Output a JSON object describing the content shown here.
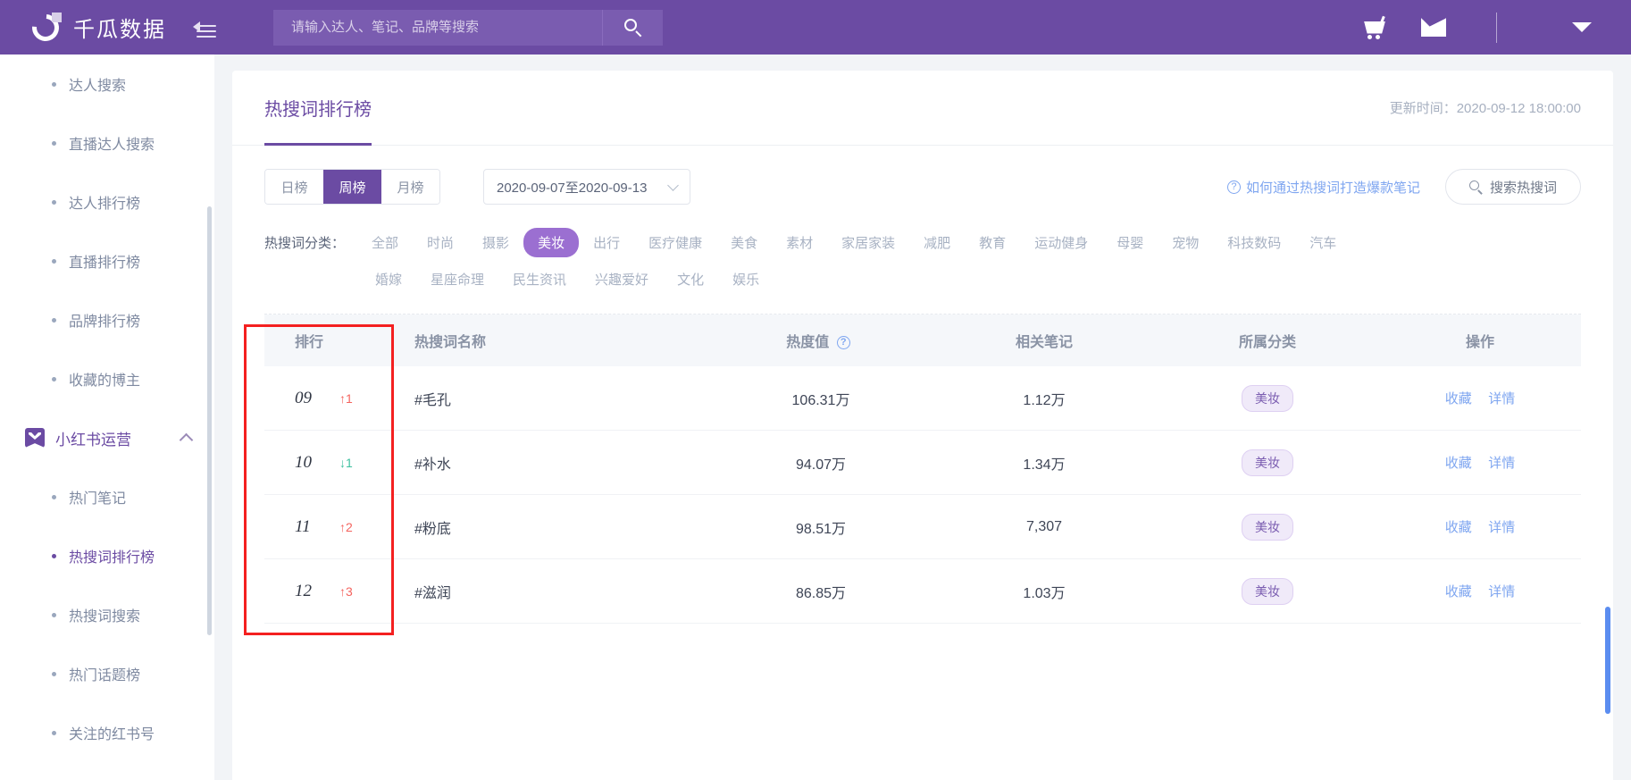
{
  "header": {
    "brand": "千瓜数据",
    "logo_icon": "crescent-logo-icon",
    "collapse_icon": "collapse-sidebar-icon",
    "search": {
      "placeholder": "请输入达人、笔记、品牌等搜索",
      "value": "",
      "button_icon": "search-icon"
    },
    "cart_icon": "shopping-cart-icon",
    "mail_icon": "mail-icon",
    "user_menu_icon": "chevron-down-icon"
  },
  "sidebar": {
    "items": [
      {
        "label": "达人搜索",
        "active": false
      },
      {
        "label": "直播达人搜索",
        "active": false
      },
      {
        "label": "达人排行榜",
        "active": false
      },
      {
        "label": "直播排行榜",
        "active": false
      },
      {
        "label": "品牌排行榜",
        "active": false
      },
      {
        "label": "收藏的博主",
        "active": false
      }
    ],
    "group": {
      "label": "小红书运营",
      "icon": "bookmark-icon",
      "chevron": "chevron-up-icon",
      "items": [
        {
          "label": "热门笔记",
          "active": false
        },
        {
          "label": "热搜词排行榜",
          "active": true
        },
        {
          "label": "热搜词搜索",
          "active": false
        },
        {
          "label": "热门话题榜",
          "active": false
        },
        {
          "label": "关注的红书号",
          "active": false
        }
      ]
    }
  },
  "main": {
    "tab_title": "热搜词排行榜",
    "update_time": "更新时间：2020-09-12 18:00:00",
    "period_tabs": [
      {
        "label": "日榜",
        "active": false
      },
      {
        "label": "周榜",
        "active": true
      },
      {
        "label": "月榜",
        "active": false
      }
    ],
    "date_range": "2020-09-07至2020-09-13",
    "help_link": "如何通过热搜词打造爆款笔记",
    "search_pill": "搜索热搜词",
    "category_label": "热搜词分类：",
    "categories_row1": [
      {
        "label": "全部",
        "active": false
      },
      {
        "label": "时尚",
        "active": false
      },
      {
        "label": "摄影",
        "active": false
      },
      {
        "label": "美妆",
        "active": true
      },
      {
        "label": "出行",
        "active": false
      },
      {
        "label": "医疗健康",
        "active": false
      },
      {
        "label": "美食",
        "active": false
      },
      {
        "label": "素材",
        "active": false
      },
      {
        "label": "家居家装",
        "active": false
      },
      {
        "label": "减肥",
        "active": false
      },
      {
        "label": "教育",
        "active": false
      },
      {
        "label": "运动健身",
        "active": false
      },
      {
        "label": "母婴",
        "active": false
      },
      {
        "label": "宠物",
        "active": false
      },
      {
        "label": "科技数码",
        "active": false
      },
      {
        "label": "汽车",
        "active": false
      }
    ],
    "categories_row2": [
      {
        "label": "婚嫁",
        "active": false
      },
      {
        "label": "星座命理",
        "active": false
      },
      {
        "label": "民生资讯",
        "active": false
      },
      {
        "label": "兴趣爱好",
        "active": false
      },
      {
        "label": "文化",
        "active": false
      },
      {
        "label": "娱乐",
        "active": false
      }
    ],
    "table": {
      "columns": {
        "rank": "排行",
        "name": "热搜词名称",
        "heat": "热度值",
        "heat_help_icon": "question-circle-icon",
        "notes": "相关笔记",
        "category": "所属分类",
        "action": "操作"
      },
      "rows": [
        {
          "rank": "09",
          "delta": "↑1",
          "delta_dir": "up",
          "name": "#毛孔",
          "heat": "106.31万",
          "notes": "1.12万",
          "category": "美妆",
          "fav": "收藏",
          "detail": "详情"
        },
        {
          "rank": "10",
          "delta": "↓1",
          "delta_dir": "down",
          "name": "#补水",
          "heat": "94.07万",
          "notes": "1.34万",
          "category": "美妆",
          "fav": "收藏",
          "detail": "详情"
        },
        {
          "rank": "11",
          "delta": "↑2",
          "delta_dir": "up",
          "name": "#粉底",
          "heat": "98.51万",
          "notes": "7,307",
          "category": "美妆",
          "fav": "收藏",
          "detail": "详情"
        },
        {
          "rank": "12",
          "delta": "↑3",
          "delta_dir": "up",
          "name": "#滋润",
          "heat": "86.85万",
          "notes": "1.03万",
          "category": "美妆",
          "fav": "收藏",
          "detail": "详情"
        }
      ]
    }
  },
  "colors": {
    "brand_purple": "#6b4ba3",
    "accent_purple": "#9b6fd1",
    "link_blue": "#7fa6f0",
    "up_red": "#f4645f",
    "down_green": "#3fc1a0",
    "annotation_red": "#f42020"
  }
}
